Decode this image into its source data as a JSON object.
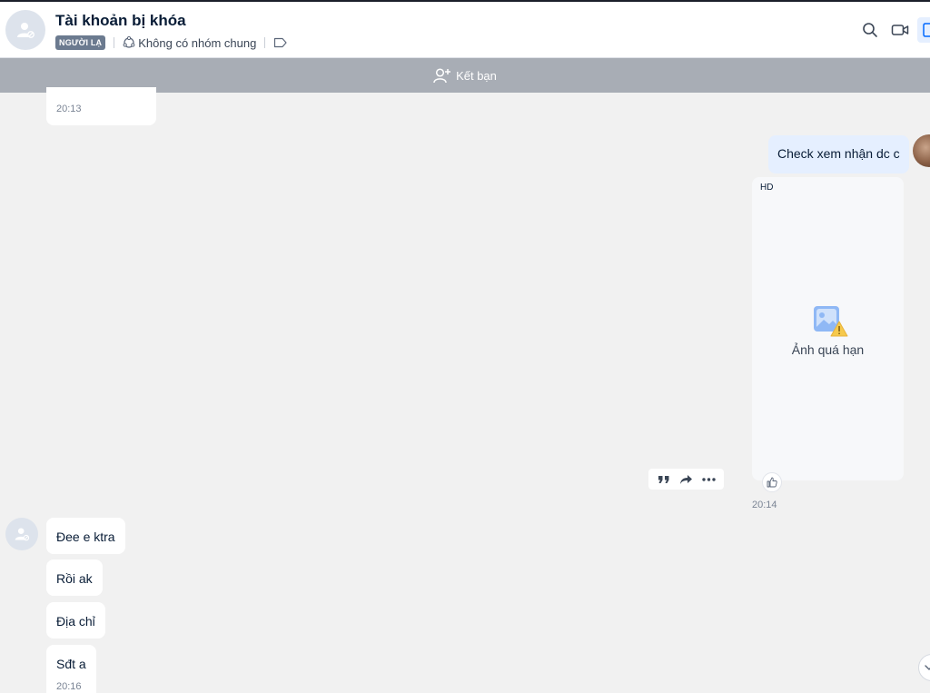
{
  "conversation": {
    "title": "Tài khoản bị khóa",
    "badge": "NGƯỜI LẠ",
    "common_groups": "Không có nhóm chung"
  },
  "friend_bar": {
    "label": "Kết bạn"
  },
  "messages": {
    "top_received_time": "20:13",
    "sent_text": "Check xem nhận dc c",
    "image_quality": "HD",
    "image_expired": "Ảnh quá hạn",
    "sent_time": "20:14",
    "received": [
      {
        "text": "Đee e ktra"
      },
      {
        "text": "Rồi ak"
      },
      {
        "text": "Địa chỉ"
      },
      {
        "text": "Sđt a",
        "time": "20:16"
      }
    ]
  },
  "icons": {
    "header": [
      "search-icon",
      "video-call-icon",
      "sidebar-toggle-icon"
    ],
    "actions": [
      "quote-icon",
      "forward-icon",
      "more-icon"
    ]
  },
  "colors": {
    "sent_bubble": "#e5efff",
    "friend_bar": "#a8adb5",
    "badge": "#6b7a8f"
  }
}
